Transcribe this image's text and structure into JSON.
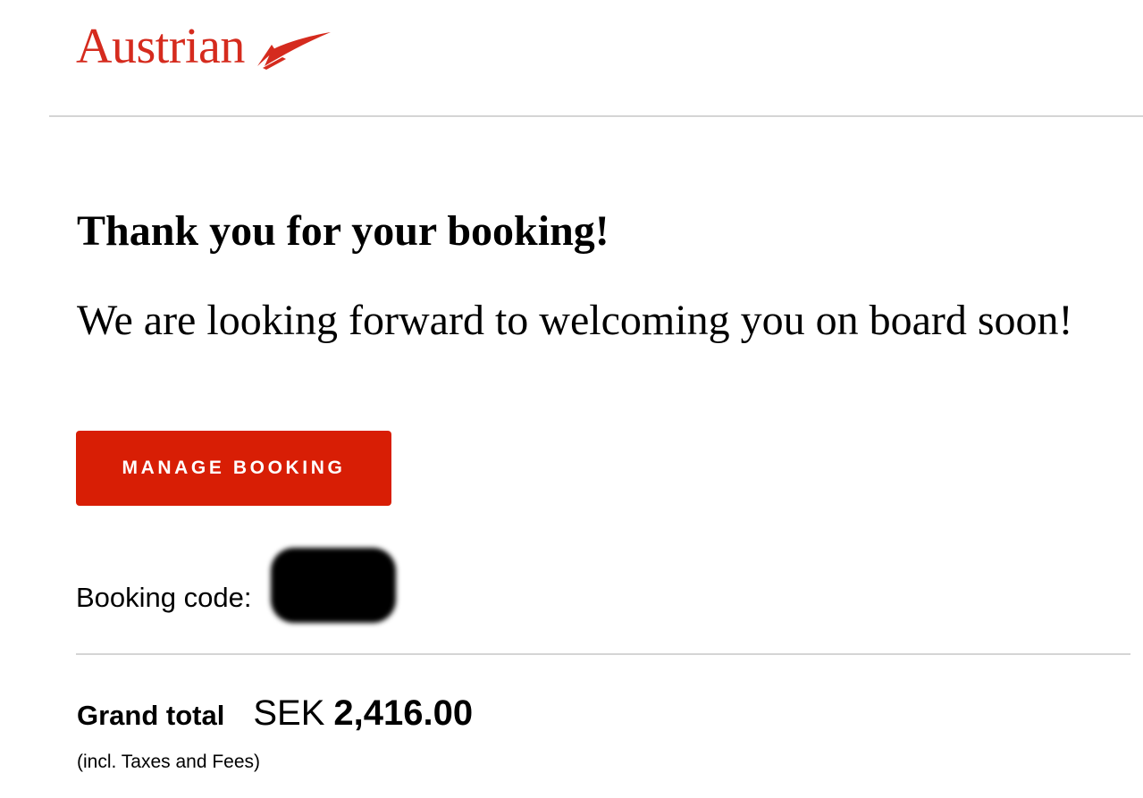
{
  "brand": {
    "name": "Austrian",
    "color": "#d52b1e",
    "logo_icon": "arrow-wing-icon"
  },
  "message": {
    "headline": "Thank you for your booking!",
    "subline": "We are looking forward to welcoming you on board soon!"
  },
  "actions": {
    "manage_booking_label": "MANAGE BOOKING",
    "button_color": "#d81e05"
  },
  "booking": {
    "code_label": "Booking code:",
    "code_value_redacted": true
  },
  "total": {
    "label": "Grand total",
    "currency": "SEK",
    "amount": "2,416.00",
    "note": "(incl. Taxes and Fees)"
  }
}
